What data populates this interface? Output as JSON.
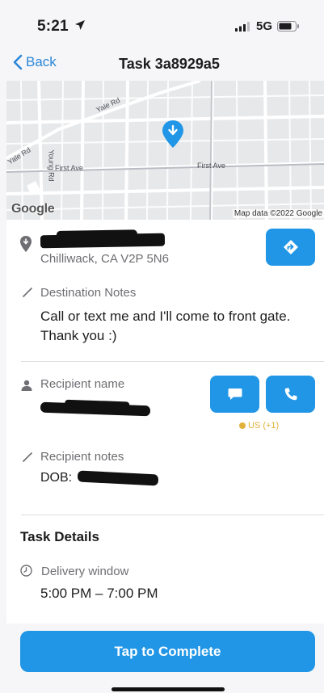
{
  "status_bar": {
    "time": "5:21",
    "network": "5G"
  },
  "nav": {
    "back_label": "Back",
    "title": "Task 3a8929a5"
  },
  "map": {
    "google_label": "Google",
    "attribution": "Map data ©2022 Google",
    "streets": [
      "Yale Rd",
      "Yale Rd",
      "Young Rd",
      "First Ave",
      "First Ave"
    ]
  },
  "destination": {
    "address_line": "Chilliwack, CA V2P 5N6",
    "notes_label": "Destination Notes",
    "notes": "Call or text me and I'll come to front gate. Thank you :)"
  },
  "recipient": {
    "name_label": "Recipient name",
    "country_code": "US (+1)",
    "notes_label": "Recipient notes",
    "dob_prefix": "DOB:"
  },
  "task_details": {
    "heading": "Task Details",
    "window_label": "Delivery window",
    "window_value": "5:00 PM – 7:00 PM"
  },
  "footer": {
    "complete_label": "Tap to Complete"
  },
  "colors": {
    "accent": "#2196e6",
    "back_link": "#2a86d8",
    "country_code": "#e2b13c"
  },
  "icons": [
    "location-arrow-icon",
    "signal-icon",
    "battery-icon",
    "chevron-left-icon",
    "map-pin-icon",
    "location-pin-icon",
    "directions-icon",
    "pencil-icon",
    "person-icon",
    "chat-icon",
    "phone-icon",
    "clock-icon"
  ]
}
